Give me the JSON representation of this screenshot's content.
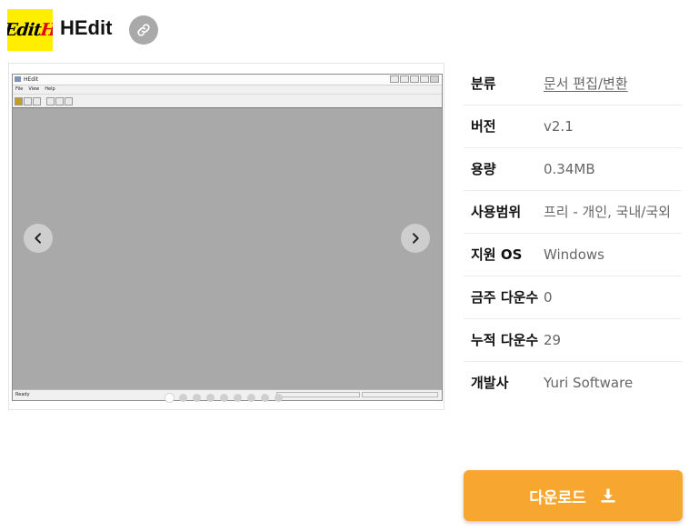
{
  "header": {
    "logo_text_main": "Edit",
    "logo_text_accent": "H",
    "title": "HEdit",
    "share_icon": "link-icon"
  },
  "screenshot": {
    "window_title": "HEdit",
    "menu": [
      "File",
      "View",
      "Help"
    ],
    "status_text": "Ready",
    "slide_count": 9,
    "active_slide": 1,
    "document_color": "#a9a9a9"
  },
  "info": {
    "rows": [
      {
        "label": "분류",
        "value": "문서 편집/변환"
      },
      {
        "label": "버전",
        "value": "v2.1"
      },
      {
        "label": "용량",
        "value": "0.34MB"
      },
      {
        "label": "사용범위",
        "value": "프리 - 개인, 국내/국외"
      },
      {
        "label": "지원 OS",
        "value": "Windows"
      },
      {
        "label": "금주 다운수",
        "value": "0"
      },
      {
        "label": "누적 다운수",
        "value": "29"
      },
      {
        "label": "개발사",
        "value": "Yuri Software"
      }
    ]
  },
  "download": {
    "label": "다운로드",
    "icon": "download-icon",
    "color": "#f7a630"
  }
}
